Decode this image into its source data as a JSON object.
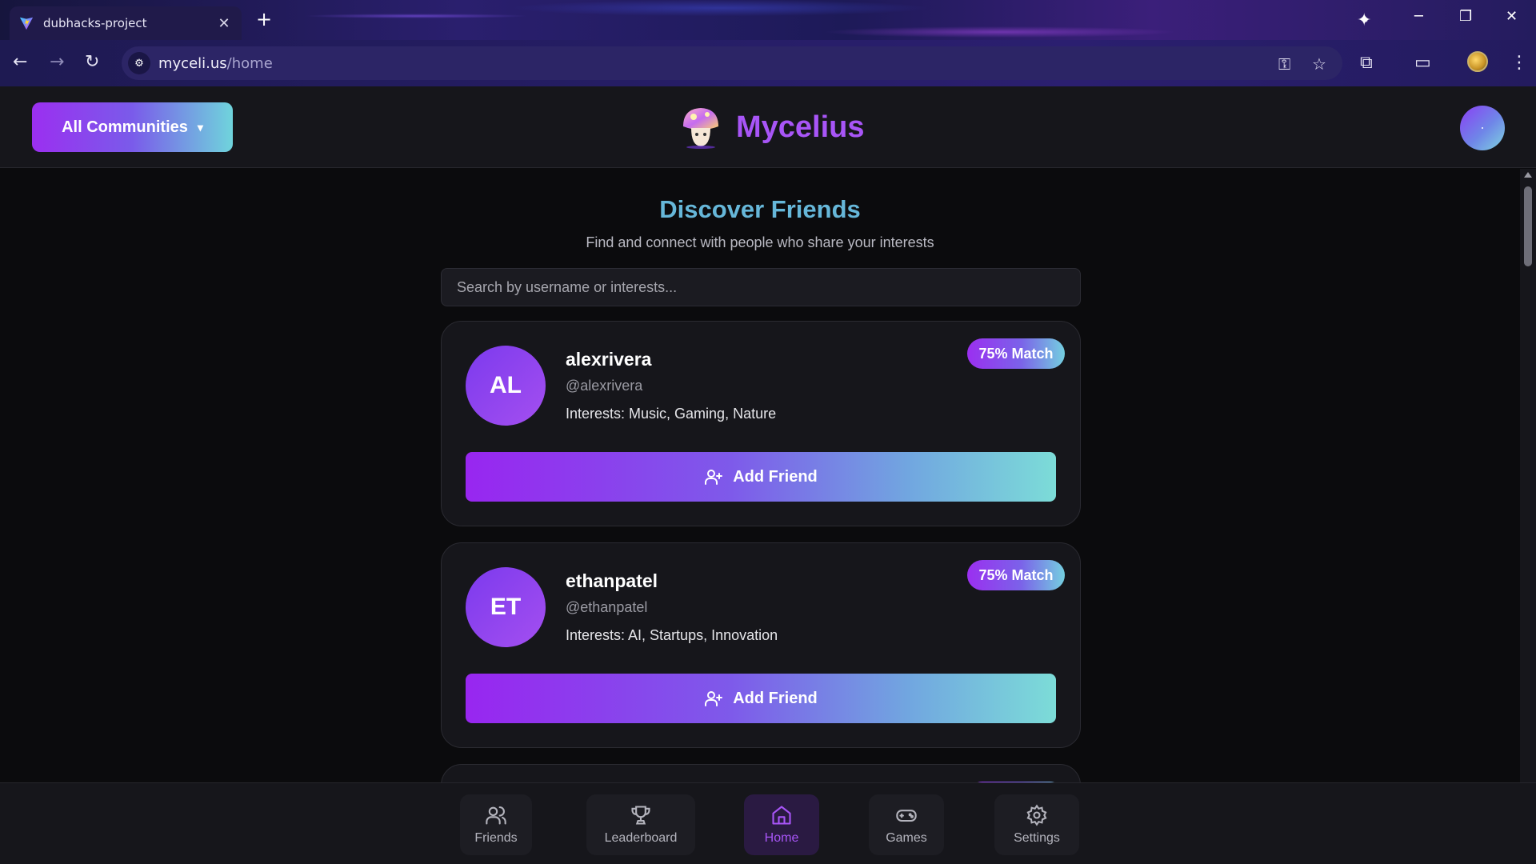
{
  "browser": {
    "tab_title": "dubhacks-project",
    "tab_close": "✕",
    "new_tab": "+",
    "url_host": "myceli.us",
    "url_path": "/home"
  },
  "header": {
    "community_selector": "All Communities",
    "app_name": "Mycelius"
  },
  "main": {
    "title": "Discover Friends",
    "subtitle": "Find and connect with people who share your interests",
    "search_placeholder": "Search by username or interests..."
  },
  "users": [
    {
      "initials": "AL",
      "name": "alexrivera",
      "handle": "@alexrivera",
      "interests": "Interests: Music, Gaming, Nature",
      "match": "75% Match",
      "action": "Add Friend"
    },
    {
      "initials": "ET",
      "name": "ethanpatel",
      "handle": "@ethanpatel",
      "interests": "Interests: AI, Startups, Innovation",
      "match": "75% Match",
      "action": "Add Friend"
    }
  ],
  "bottom_nav": {
    "friends": "Friends",
    "leaderboard": "Leaderboard",
    "home": "Home",
    "games": "Games",
    "settings": "Settings",
    "active": "Home"
  },
  "colors": {
    "accent_purple": "#a855f7",
    "accent_teal": "#6fd4dc",
    "title_blue": "#66b7d9",
    "card_bg": "#16161b",
    "page_bg": "#0b0b0d"
  }
}
